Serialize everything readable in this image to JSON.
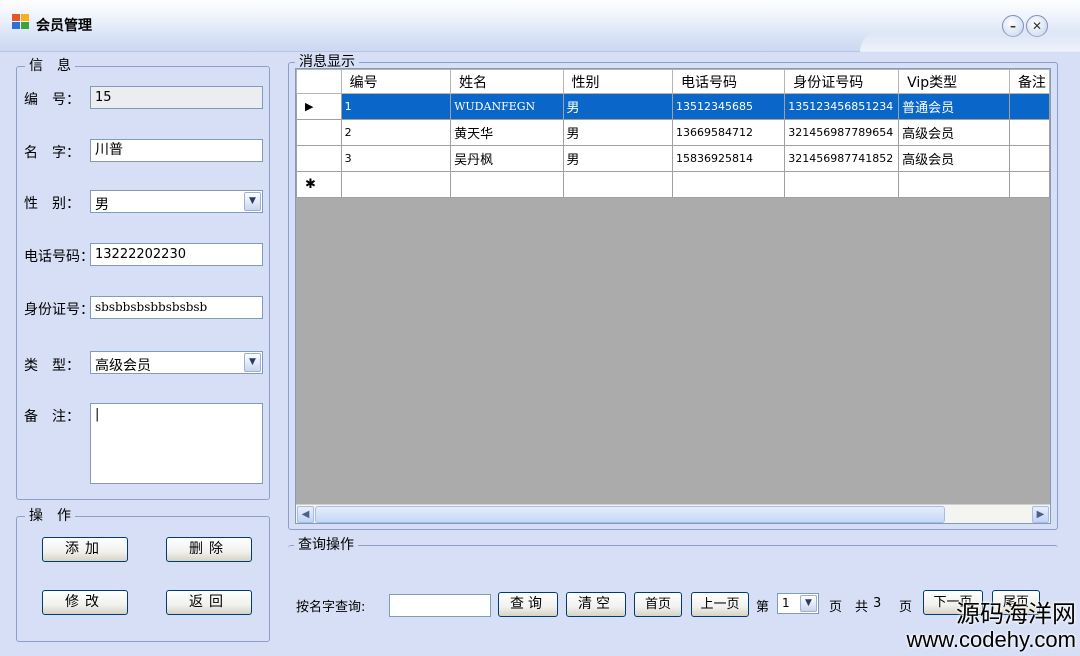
{
  "window": {
    "title": "会员管理",
    "min_glyph": "–",
    "close_glyph": "✕"
  },
  "info": {
    "legend": "信　息",
    "id_label": "编　号：",
    "id_value": "15",
    "name_label": "名　字：",
    "name_value": "川普",
    "gender_label": "性　别：",
    "gender_value": "男",
    "phone_label": "电话号码：",
    "phone_value": "13222202230",
    "idcard_label": "身份证号：",
    "idcard_value": "sbsbbsbsbbsbsbsb",
    "type_label": "类　型：",
    "type_value": "高级会员",
    "note_label": "备　注：",
    "note_value": "|"
  },
  "actions": {
    "legend": "操　作",
    "add": "添加",
    "delete": "删除",
    "edit": "修改",
    "back": "返回"
  },
  "grid": {
    "legend": "消息显示",
    "columns": [
      "编号",
      "姓名",
      "性别",
      "电话号码",
      "身份证号码",
      "Vip类型",
      "备注"
    ],
    "rows": [
      {
        "marker": "▶",
        "id": "1",
        "name": "WUDANFEGN",
        "gender": "男",
        "phone": "13512345685",
        "idcard": "135123456851234",
        "type": "普通会员",
        "note": ""
      },
      {
        "marker": "",
        "id": "2",
        "name": "黄天华",
        "gender": "男",
        "phone": "13669584712",
        "idcard": "321456987789654",
        "type": "高级会员",
        "note": ""
      },
      {
        "marker": "",
        "id": "3",
        "name": "吴丹枫",
        "gender": "男",
        "phone": "15836925814",
        "idcard": "321456987741852",
        "type": "高级会员",
        "note": ""
      }
    ],
    "new_row_marker": "✱",
    "selected_row_color": "#0a66c8"
  },
  "query": {
    "legend": "查询操作",
    "search_label": "按名字查询:",
    "search_value": "",
    "search_btn": "查询",
    "clear_btn": "清空",
    "first_btn": "首页",
    "prev_btn": "上一页",
    "page_prefix": "第",
    "page_value": "1",
    "page_suffix": "页",
    "total_prefix": "共",
    "total_pages": "3",
    "total_suffix": "页",
    "next_btn": "下一页",
    "last_btn": "尾页"
  },
  "watermark": {
    "line1": "源码海洋网",
    "line2": "www.codehy.com"
  }
}
